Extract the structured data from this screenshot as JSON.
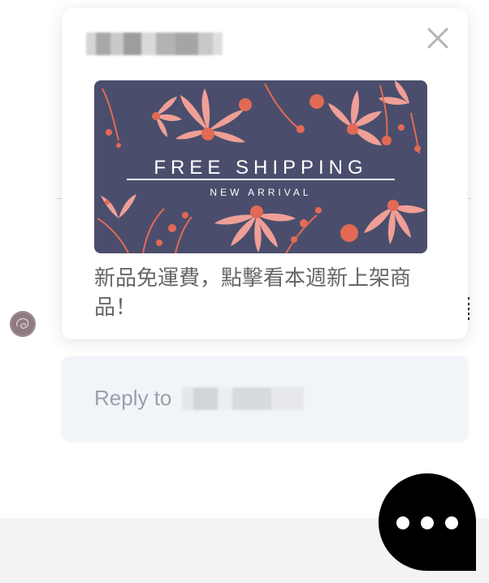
{
  "popup": {
    "sender_name": "",
    "banner": {
      "title": "FREE SHIPPING",
      "subtitle": "NEW ARRIVAL",
      "background_color": "#4a4e6c",
      "flower_color": "#ef9f96",
      "accent_color": "#e26a55"
    },
    "message": "新品免運費，點擊看本週新上架商品！",
    "close_icon": "close-icon"
  },
  "reply": {
    "prefix": "Reply to",
    "recipient": ""
  },
  "launcher": {
    "icon": "ellipsis-icon",
    "color": "#000000"
  },
  "avatar": {
    "icon": "avatar-icon"
  }
}
